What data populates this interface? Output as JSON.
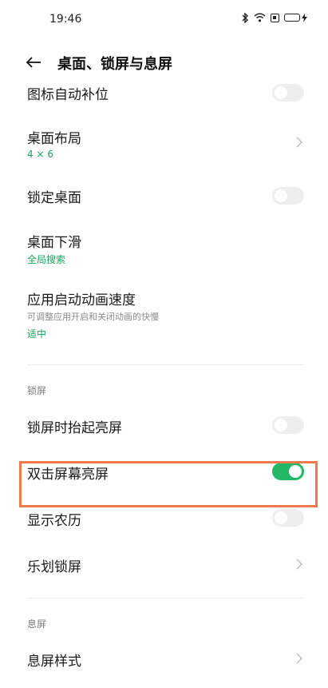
{
  "status_bar": {
    "time": "19:46",
    "bluetooth_icon": "bluetooth-icon",
    "wifi_icon": "wifi-icon",
    "sim_icon": "sim-icon",
    "battery_icon": "battery-charging-icon"
  },
  "header": {
    "back_icon": "back-arrow-icon",
    "title": "桌面、锁屏与息屏"
  },
  "items": {
    "auto_fill": {
      "title": "图标自动补位",
      "toggle": "off"
    },
    "desktop_layout": {
      "title": "桌面布局",
      "value": "4 × 6"
    },
    "lock_desktop": {
      "title": "锁定桌面",
      "toggle": "off"
    },
    "swipe_down": {
      "title": "桌面下滑",
      "value": "全局搜索"
    },
    "animation_speed": {
      "title": "应用启动动画速度",
      "desc": "可调整应用开启和关闭动画的快慢",
      "value": "适中"
    },
    "lift_to_wake": {
      "title": "锁屏时抬起亮屏",
      "toggle": "off"
    },
    "double_tap_wake": {
      "title": "双击屏幕亮屏",
      "toggle": "on"
    },
    "lunar_calendar": {
      "title": "显示农历",
      "toggle": "off"
    },
    "lehua_lockscreen": {
      "title": "乐划锁屏"
    },
    "screen_off_style": {
      "title": "息屏样式"
    }
  },
  "sections": {
    "lockscreen": "锁屏",
    "screen_off": "息屏"
  },
  "colors": {
    "accent_green": "#1aa35b",
    "toggle_on": "#24b765",
    "toggle_off": "#eeeeee",
    "highlight": "#f07a4a"
  }
}
